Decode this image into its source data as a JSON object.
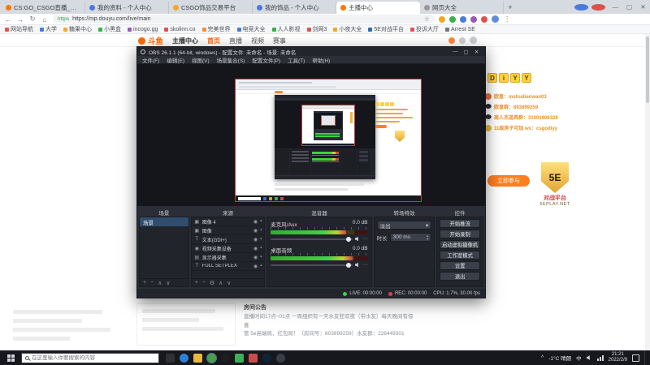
{
  "theme": {
    "accent_orange": "#ff6a00",
    "obs_background": "#2b2e37",
    "meter_green": "#3fd13f",
    "badge_gold": "#ffd243",
    "button_orange": "#ff7e1e"
  },
  "icons": {
    "back": "←",
    "forward": "→",
    "refresh": "↻",
    "home": "⌂",
    "star": "☆",
    "menu": "⋮",
    "min": "—",
    "max": "▢",
    "close": "✕",
    "plus": "+",
    "minus": "−",
    "up": "∧",
    "down": "∨",
    "gear": "⚙",
    "dropdown": "▾",
    "spin_up": "▴",
    "spin_down": "▾",
    "eye": "◉",
    "lock": "▪",
    "image": "▣",
    "text": "T",
    "camera": "◉",
    "display": "▤",
    "caret_up": "^",
    "dots": "⋯"
  },
  "browser": {
    "tabs": [
      {
        "label": "CS:GO_CSGO直播_CS:G…"
      },
      {
        "label": "我的资料 - 个人中心"
      },
      {
        "label": "CSGO饰品交易平台"
      },
      {
        "label": "我的饰品 - 个人中心"
      },
      {
        "label": "主播中心"
      },
      {
        "label": "网页大全"
      }
    ],
    "new_tab": "+",
    "address_url": "https://mp.douyu.com/live/main",
    "https_label": "https",
    "bookmarks": [
      "网站导航",
      "大学",
      "糖果中心",
      "小黑盒",
      "incogo.gg",
      "skolinn.co",
      "完美世界",
      "电竞大全",
      "人人影视",
      "剑网3",
      "小夜大全",
      "5E对战平台",
      "投诉大厅",
      "Arrest SE"
    ]
  },
  "site_header": {
    "logo": "斗鱼",
    "section": "主播中心",
    "nav": [
      "首页",
      "直播",
      "视频",
      "赛事"
    ]
  },
  "overlay": {
    "keycaps": [
      "D",
      "i",
      "Y",
      "Y"
    ],
    "lines": [
      {
        "icon": "fish-icon",
        "text": "欧皇：mshudianwan03"
      },
      {
        "icon": "penguin-icon",
        "text": "欧皇群：893899259"
      },
      {
        "icon": "penguin-icon",
        "text": "商人杰道具群：31001906328"
      },
      {
        "icon": "key-icon",
        "text": "11级房子可加 wx：csgodiyy"
      }
    ],
    "join_button": "立即参与",
    "badge": {
      "main": "5E",
      "tagline": "对战平台",
      "site": "5EPLAY.NET"
    }
  },
  "announcement": {
    "title": "房间公告",
    "lines": [
      "直播时间17点~01点 一周组织有一天水友狂欢夜（带水友）每天晚间有惊喜",
      "管 5e高端局、红包局！（房间号：803899259）水友群：226449301"
    ]
  },
  "obs": {
    "title": "OBS 26.1.1 (64-bit, windows) - 配置文件: 未命名 - 场景: 未命名",
    "menus": [
      "文件(F)",
      "编辑(E)",
      "视图(V)",
      "场景集合(S)",
      "配置文件(P)",
      "工具(T)",
      "帮助(H)"
    ],
    "scenes": {
      "title": "场景",
      "items": [
        "场景"
      ]
    },
    "sources": {
      "title": "来源",
      "items": [
        {
          "name": "图像 4",
          "type": "image-source-icon"
        },
        {
          "name": "图像",
          "type": "image-source-icon"
        },
        {
          "name": "文本(GDI+)",
          "type": "text-source-icon"
        },
        {
          "name": "视频采集设备",
          "type": "camera-source-icon"
        },
        {
          "name": "显示器采集",
          "type": "display-source-icon"
        },
        {
          "name": "FULL SETPLEX",
          "type": "text-source-icon"
        }
      ]
    },
    "mixer": {
      "title": "混音器",
      "channels": [
        {
          "name": "麦克风/Aux",
          "db": "0.0 dB",
          "level_pct": 78
        },
        {
          "name": "桌面音频",
          "db": "0.0 dB",
          "level_pct": 84
        }
      ]
    },
    "transitions": {
      "title": "转场特效",
      "selected": "淡出",
      "duration_label": "时长",
      "duration_value": "300 ms"
    },
    "controls": {
      "title": "控件",
      "buttons": [
        "开始推流",
        "开始录制",
        "启动虚拟摄像机",
        "工作室模式",
        "设置",
        "退出"
      ]
    },
    "status": {
      "live": "LIVE: 00:00:00",
      "rec": "REC: 00:00:00",
      "cpu": "CPU: 1.7%, 30.00 fps"
    }
  },
  "taskbar": {
    "search_placeholder": "在这里输入你要搜索的内容",
    "weather": "-1°C 晴朗",
    "ime": "中",
    "time": "21:21",
    "date": "2022/2/9"
  }
}
